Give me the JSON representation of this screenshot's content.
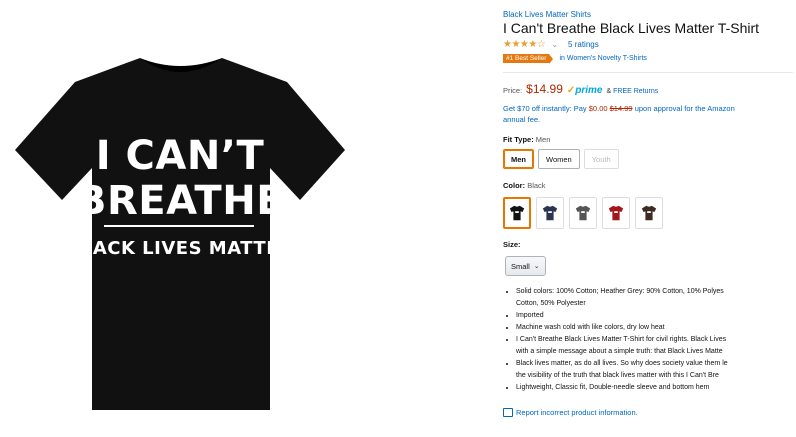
{
  "product": {
    "brand_link": "Black Lives Matter Shirts",
    "title": "I Can't Breathe Black Lives Matter T-Shirt",
    "stars_full": "★★★",
    "stars_rest": "★☆",
    "rating_value": 3.5,
    "ratings_link": "5 ratings",
    "best_seller_badge": "#1 Best Seller",
    "best_seller_category": "in Women's Novelty T-Shirts",
    "shirt_print": {
      "line1": "I CAN’T",
      "line2": "BREATHE",
      "line3": "BLACK LIVES MATTER"
    }
  },
  "price": {
    "label": "Price:",
    "value": "$14.99",
    "prime": "prime",
    "prime_check": "✓",
    "free_returns_prefix": "&",
    "free_returns": "FREE Returns"
  },
  "promo": {
    "part1": "Get $70 off instantly: Pay",
    "pay": "$0.00",
    "struck": "$14.99",
    "part2": "upon approval for the Amazon",
    "part3": "annual fee."
  },
  "fit": {
    "label": "Fit Type:",
    "value": "Men",
    "options": [
      "Men",
      "Women",
      "Youth"
    ]
  },
  "color": {
    "label": "Color:",
    "value": "Black",
    "swatches": [
      {
        "name": "Black",
        "hex": "#111111"
      },
      {
        "name": "Navy",
        "hex": "#2b3550"
      },
      {
        "name": "Heather Grey",
        "hex": "#555555"
      },
      {
        "name": "Red",
        "hex": "#a4161a"
      },
      {
        "name": "Brown",
        "hex": "#3d2b22"
      }
    ]
  },
  "size": {
    "label": "Size:",
    "value": "Small"
  },
  "bullets": [
    "Solid colors: 100% Cotton; Heather Grey: 90% Cotton, 10% Polyes",
    "Cotton, 50% Polyester",
    "Imported",
    "Machine wash cold with like colors, dry low heat",
    "I Can't Breathe Black Lives Matter T-Shirt for civil rights. Black Lives",
    "with a simple message about a simple truth: that Black Lives Matte",
    "Black lives matter, as do all lives. So why does society value them le",
    "the visibility of the truth that black lives matter with this I Can't Bre",
    "Lightweight, Classic fit, Double-needle sleeve and bottom hem"
  ],
  "report_link": "Report incorrect product information.",
  "colors": {
    "link": "#0066c0",
    "price": "#b12704",
    "badge": "#e47911",
    "selected": "#e77600",
    "shirt": "#111111"
  },
  "icons": [
    "shirt-product-image",
    "chevron-down-icon",
    "prime-check-icon",
    "tee-icon",
    "report-icon"
  ]
}
